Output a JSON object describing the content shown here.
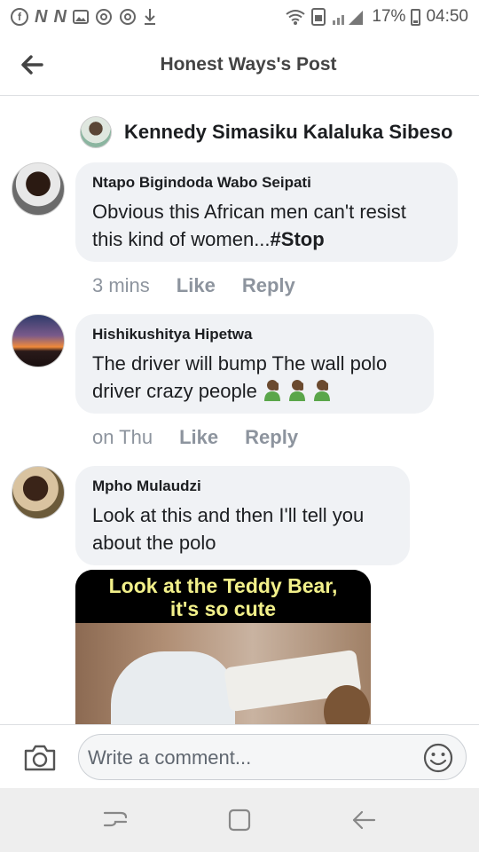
{
  "status_bar": {
    "battery": "17%",
    "time": "04:50",
    "notification_icons": [
      "facebook-icon",
      "n-icon",
      "n-icon",
      "image-icon",
      "circle-icon",
      "circle-icon",
      "download-icon"
    ],
    "n_glyph": "N",
    "fb_glyph": "f"
  },
  "header": {
    "title": "Honest Ways's Post"
  },
  "reply_to": {
    "name": "Kennedy Simasiku Kalaluka Sibeso"
  },
  "comments": [
    {
      "author": "Ntapo Bigindoda Wabo Seipati",
      "text_plain": "Obvious this African men can't resist this kind of women...",
      "hashtag": "#Stop",
      "time": "3 mins",
      "like": "Like",
      "reply": "Reply"
    },
    {
      "author": "Hishikushitya Hipetwa",
      "text": "The driver will bump The wall polo driver crazy people",
      "emoji": [
        "facepalm-emoji",
        "facepalm-emoji",
        "facepalm-emoji"
      ],
      "time": "on Thu",
      "like": "Like",
      "reply": "Reply"
    },
    {
      "author": "Mpho Mulaudzi",
      "text": "Look at this and then I'll tell you about the polo",
      "image_caption_line1": "Look at the Teddy Bear,",
      "image_caption_line2": "it's so cute"
    }
  ],
  "composer": {
    "placeholder": "Write a comment..."
  },
  "colors": {
    "bubble": "#f0f2f5",
    "meta": "#8d949e",
    "meme_caption": "#f2f08a"
  }
}
